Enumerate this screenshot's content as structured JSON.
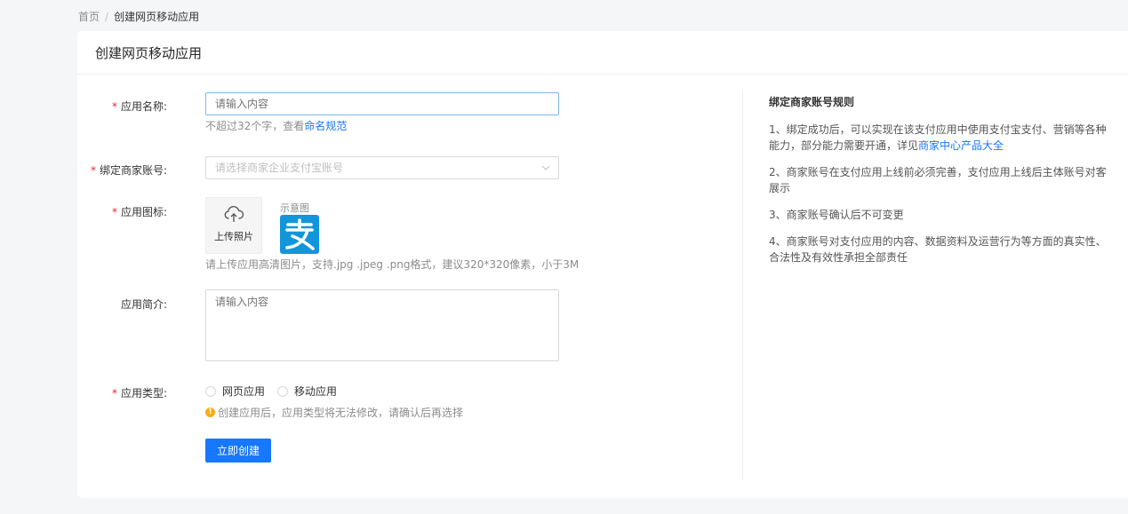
{
  "breadcrumb": {
    "home": "首页",
    "separator": "/",
    "current": "创建网页移动应用"
  },
  "page": {
    "title": "创建网页移动应用"
  },
  "form": {
    "app_name": {
      "label": "应用名称:",
      "placeholder": "请输入内容",
      "help_prefix": "不超过32个字，查看",
      "help_link": "命名规范"
    },
    "merchant": {
      "label": "绑定商家账号:",
      "placeholder": "请选择商家企业支付宝账号"
    },
    "icon": {
      "label": "应用图标:",
      "upload_label": "上传照片",
      "sample_label": "示意图",
      "sample_glyph": "支",
      "help": "请上传应用高清图片，支持.jpg .jpeg .png格式，建议320*320像素，小于3M"
    },
    "intro": {
      "label": "应用简介:",
      "placeholder": "请输入内容"
    },
    "type": {
      "label": "应用类型:",
      "options": [
        "网页应用",
        "移动应用"
      ],
      "warning": "创建应用后，应用类型将无法修改，请确认后再选择"
    },
    "submit_label": "立即创建"
  },
  "rules": {
    "title": "绑定商家账号规则",
    "item1_text": "1、绑定成功后，可以实现在该支付应用中使用支付宝支付、营销等各种能力，部分能力需要开通，详见",
    "item1_link": "商家中心产品大全",
    "item2": "2、商家账号在支付应用上线前必须完善，支付应用上线后主体账号对客展示",
    "item3": "3、商家账号确认后不可变更",
    "item4": "4、商家账号对支付应用的内容、数据资料及运营行为等方面的真实性、合法性及有效性承担全部责任"
  },
  "colors": {
    "primary": "#1677ff",
    "required": "#f5222d",
    "warning": "#faad14",
    "alipay": "#1296db"
  },
  "icons": {
    "upload": "cloud-upload-icon",
    "select": "chevron-down-icon",
    "sample": "alipay-logo-icon",
    "warning": "warning-circle-icon"
  }
}
